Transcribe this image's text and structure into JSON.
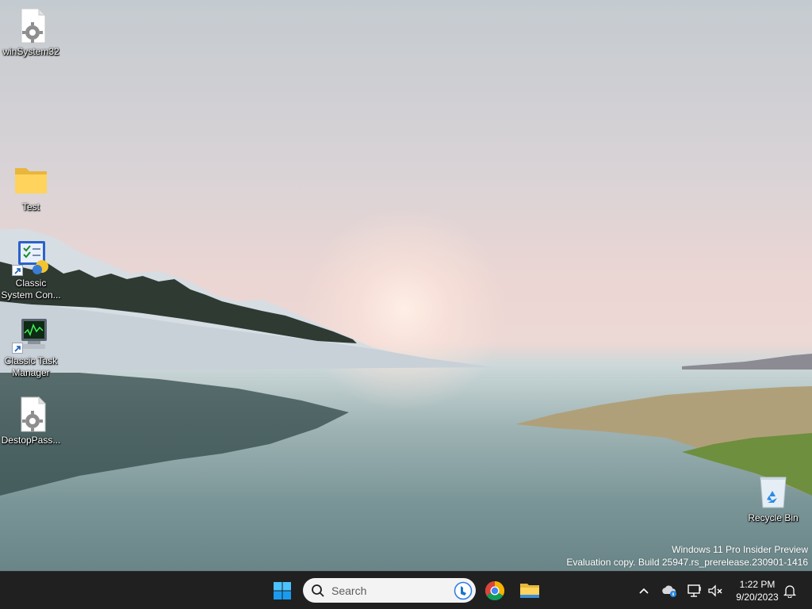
{
  "desktop": {
    "icons": [
      {
        "name": "desktop-icon-winsystem32",
        "label": "winSystem32",
        "icon": "settings-file-icon"
      },
      {
        "name": "desktop-icon-test",
        "label": "Test",
        "icon": "folder-icon"
      },
      {
        "name": "desktop-icon-classic-system-control",
        "label": "Classic System Con...",
        "icon": "system-control-icon",
        "shortcut": true
      },
      {
        "name": "desktop-icon-classic-task-manager",
        "label": "Classic Task Manager",
        "icon": "task-manager-icon",
        "shortcut": true
      },
      {
        "name": "desktop-icon-destoppass",
        "label": "DestopPass...",
        "icon": "settings-file-icon"
      },
      {
        "name": "desktop-icon-recycle-bin",
        "label": "Recycle Bin",
        "icon": "recycle-bin-icon"
      }
    ],
    "watermark": {
      "line1": "Windows 11 Pro Insider Preview",
      "line2": "Evaluation copy. Build 25947.rs_prerelease.230901-1416"
    }
  },
  "taskbar": {
    "search_placeholder": "Search",
    "pinned": [
      {
        "name": "start-button",
        "icon": "windows-logo-icon"
      },
      {
        "name": "chrome-button",
        "icon": "chrome-icon"
      },
      {
        "name": "file-explorer-button",
        "icon": "folder-icon"
      }
    ],
    "tray": {
      "time": "1:22 PM",
      "date": "9/20/2023",
      "icons": [
        "chevron-up-icon",
        "onedrive-icon",
        "network-icon",
        "volume-muted-icon",
        "notification-bell-icon"
      ]
    }
  },
  "colors": {
    "taskbar_bg": "#202020",
    "search_bg": "#f3f3f3",
    "accent": "#0078d4"
  }
}
